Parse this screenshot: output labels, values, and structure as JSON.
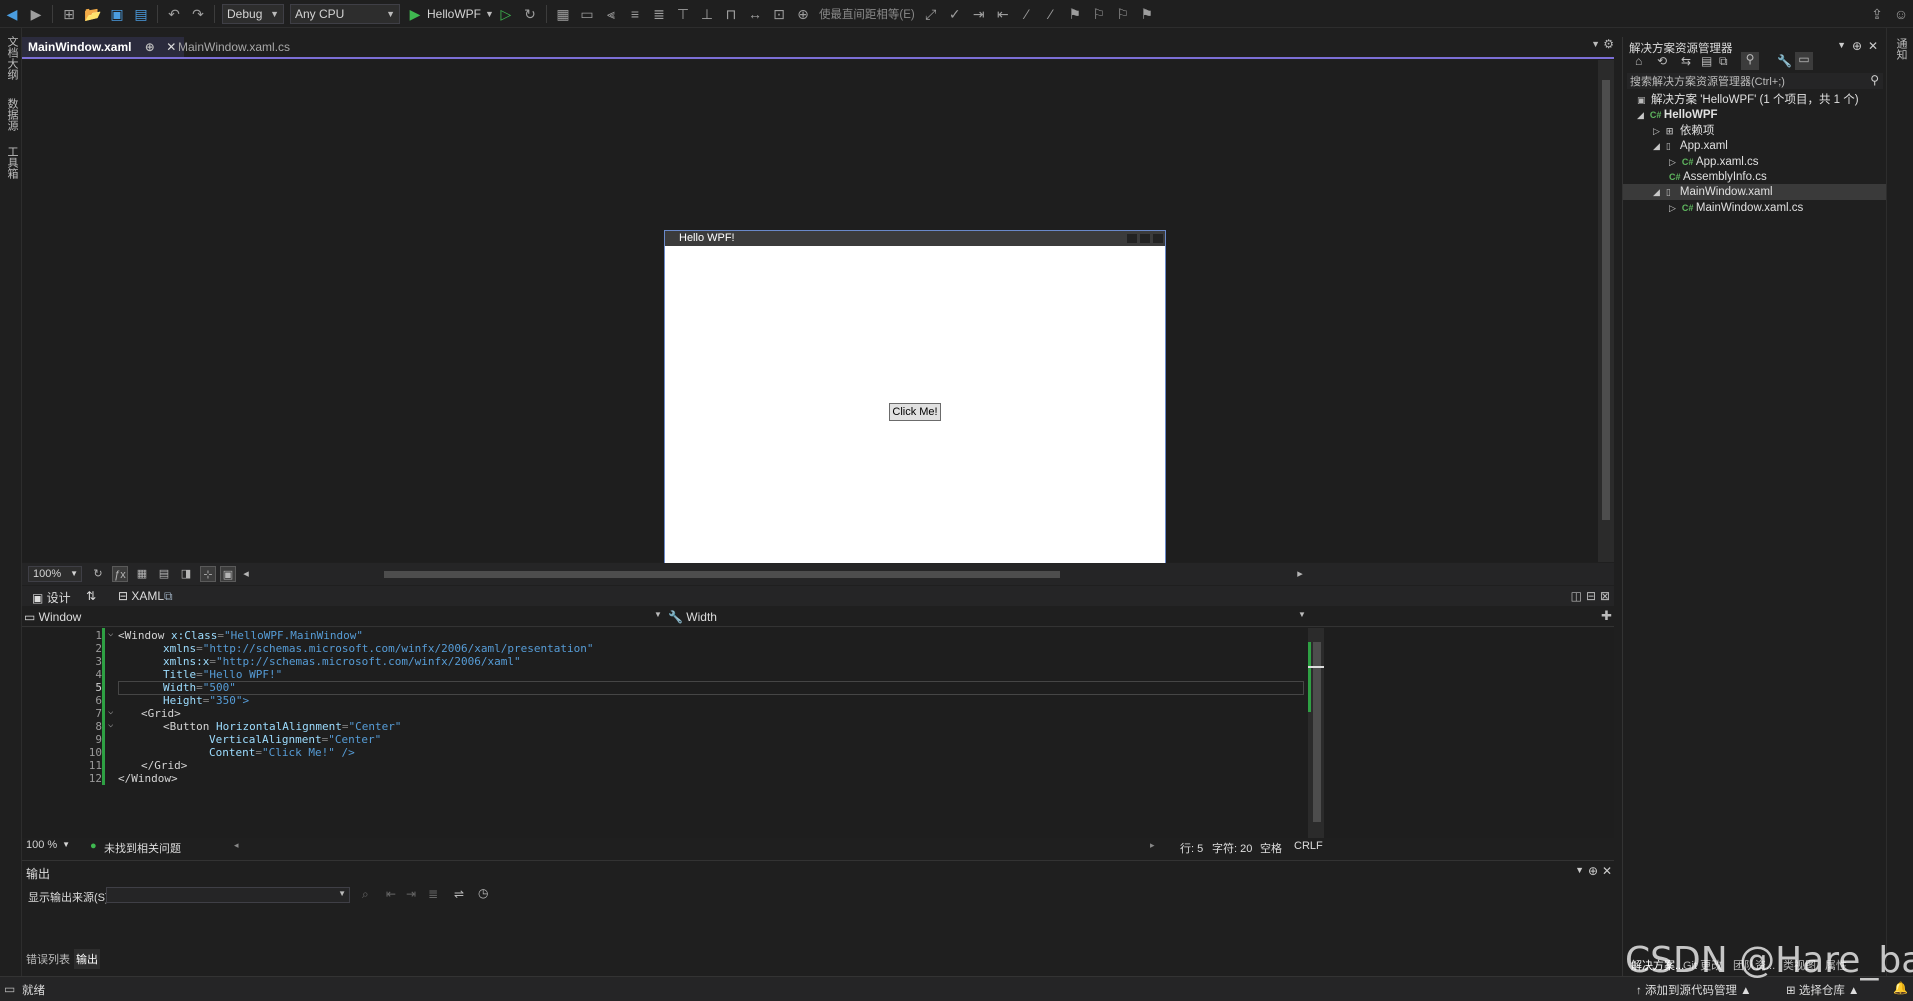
{
  "toolbar": {
    "config": "Debug",
    "platform": "Any CPU",
    "run_label": "HelloWPF",
    "nav_text": "使最直间距相等(E)"
  },
  "left_strip": {
    "items": [
      "文档大纲",
      "数据源",
      "工具箱"
    ]
  },
  "tabs": [
    {
      "label": "MainWindow.xaml",
      "pin": "⊕",
      "active": true
    },
    {
      "label": "MainWindow.xaml.cs",
      "active": false
    }
  ],
  "preview": {
    "title": "Hello WPF!",
    "button": "Click Me!"
  },
  "designer_bar": {
    "zoom": "100%"
  },
  "split_bar": {
    "design_label": "设计",
    "xaml_label": "XAML"
  },
  "xml_path": {
    "element": "Window",
    "property": "Width"
  },
  "code": {
    "current_line": 5,
    "lines": [
      {
        "n": "1"
      },
      {
        "n": "2"
      },
      {
        "n": "3"
      },
      {
        "n": "4"
      },
      {
        "n": "5"
      },
      {
        "n": "6"
      },
      {
        "n": "7"
      },
      {
        "n": "8"
      },
      {
        "n": "9"
      },
      {
        "n": "10"
      },
      {
        "n": "11"
      },
      {
        "n": "12"
      }
    ]
  },
  "code_text": {
    "l1_tag": "<Window",
    "l1_attr": "x:Class",
    "l1_val": "\"HelloWPF.MainWindow\"",
    "l2_attr": "xmlns",
    "l2_val": "\"http://schemas.microsoft.com/winfx/2006/xaml/presentation\"",
    "l3_attr": "xmlns:x",
    "l3_val": "\"http://schemas.microsoft.com/winfx/2006/xaml\"",
    "l4_attr": "Title",
    "l4_val": "\"Hello WPF!\"",
    "l5_attr": "Width",
    "l5_val": "\"500\"",
    "l6_attr": "Height",
    "l6_val": "\"350\">",
    "l7_tag": "<Grid>",
    "l8_tag": "<Button",
    "l8_attr": "HorizontalAlignment",
    "l8_val": "\"Center\"",
    "l9_attr": "VerticalAlignment",
    "l9_val": "\"Center\"",
    "l10_attr": "Content",
    "l10_val": "\"Click Me!\" />",
    "l11_tag": "</Grid>",
    "l12_tag": "</Window>"
  },
  "editor_status": {
    "zoom": "100 %",
    "issues": "未找到相关问题",
    "row": "行: 5",
    "col": "字符: 20",
    "spaces": "空格",
    "eol": "CRLF"
  },
  "output": {
    "title": "输出",
    "source_label": "显示输出来源(S):",
    "source_value": ""
  },
  "bottom_tabs": [
    "错误列表",
    "输出"
  ],
  "solution": {
    "header": "解决方案资源管理器",
    "search_placeholder": "搜索解决方案资源管理器(Ctrl+;)",
    "items": [
      {
        "label": "解决方案 'HelloWPF' (1 个项目，共 1 个)",
        "icon": "solution-icon"
      },
      {
        "label": "HelloWPF",
        "icon": "csharp-project-icon"
      },
      {
        "label": "依赖项",
        "icon": "dependencies-icon"
      },
      {
        "label": "App.xaml",
        "icon": "xaml-file-icon"
      },
      {
        "label": "App.xaml.cs",
        "icon": "csharp-file-icon"
      },
      {
        "label": "AssemblyInfo.cs",
        "icon": "csharp-file-icon"
      },
      {
        "label": "MainWindow.xaml",
        "icon": "xaml-file-icon"
      },
      {
        "label": "MainWindow.xaml.cs",
        "icon": "csharp-file-icon"
      }
    ],
    "bottom_tabs": [
      "解决方案...",
      "Git 更改",
      "团队资...",
      "类视图",
      "属性"
    ]
  },
  "right_strip": {
    "items": [
      "通知"
    ]
  },
  "statusbar": {
    "ready": "就绪",
    "add_source": "添加到源代码管理",
    "select_repo": "选择仓库"
  },
  "watermark": "CSDN @Hare_bai"
}
